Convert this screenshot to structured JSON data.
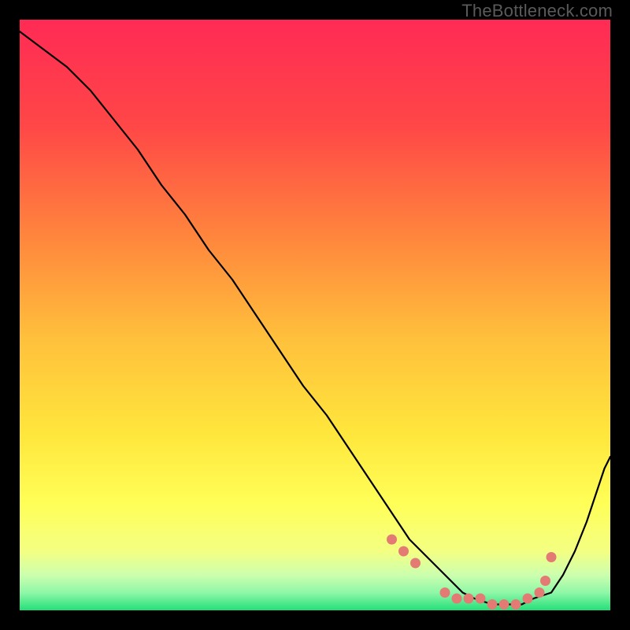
{
  "watermark": "TheBottleneck.com",
  "chart_data": {
    "type": "line",
    "title": "",
    "xlabel": "",
    "ylabel": "",
    "xlim": [
      0,
      100
    ],
    "ylim": [
      0,
      100
    ],
    "grid": false,
    "legend": false,
    "background_gradient": {
      "top": "#ff2a55",
      "mid_upper": "#ff7a3a",
      "mid": "#ffd93a",
      "mid_lower": "#ffff66",
      "band_light": "#e8ffb0",
      "bottom": "#2bdf7a"
    },
    "series": [
      {
        "name": "bottleneck-curve",
        "color": "#000000",
        "x": [
          0,
          4,
          8,
          12,
          16,
          20,
          24,
          28,
          32,
          36,
          40,
          44,
          48,
          52,
          56,
          60,
          62,
          64,
          66,
          69,
          71,
          73,
          75,
          77,
          80,
          82,
          85,
          87,
          90,
          92,
          94,
          96,
          97,
          99,
          100
        ],
        "y": [
          98,
          95,
          92,
          88,
          83,
          78,
          72,
          67,
          61,
          56,
          50,
          44,
          38,
          33,
          27,
          21,
          18,
          15,
          12,
          9,
          7,
          5,
          3,
          2,
          1,
          1,
          1,
          2,
          3,
          6,
          10,
          15,
          18,
          24,
          26
        ]
      }
    ],
    "marker_points": {
      "name": "highlight-dots",
      "color": "#e37b74",
      "x": [
        63,
        65,
        67,
        72,
        74,
        76,
        78,
        80,
        82,
        84,
        86,
        88,
        89,
        90
      ],
      "y": [
        12,
        10,
        8,
        3,
        2,
        2,
        2,
        1,
        1,
        1,
        2,
        3,
        5,
        9
      ]
    }
  }
}
